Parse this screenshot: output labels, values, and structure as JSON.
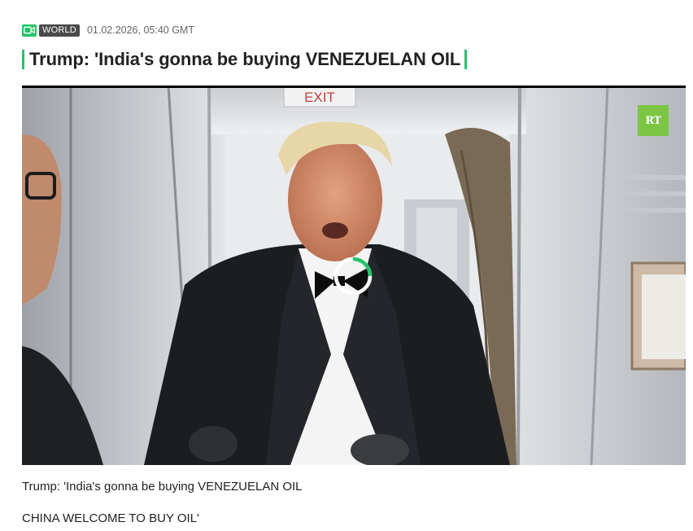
{
  "article": {
    "category": "WORLD",
    "date": "01.02.2026, 05:40 GMT",
    "title": "Trump: 'India's gonna be buying VENEZUELAN OIL"
  },
  "video": {
    "watermark": "RT",
    "sign_text": "EXIT",
    "state": "loading",
    "accent_color": "#25c46a",
    "logo_color": "#7cc644"
  },
  "body": {
    "paragraphs": [
      "Trump: 'India's gonna be buying VENEZUELAN OIL",
      "CHINA WELCOME TO BUY OIL'"
    ]
  },
  "icons": {
    "category": "video-camera-icon",
    "player": "loading-spinner-icon"
  }
}
